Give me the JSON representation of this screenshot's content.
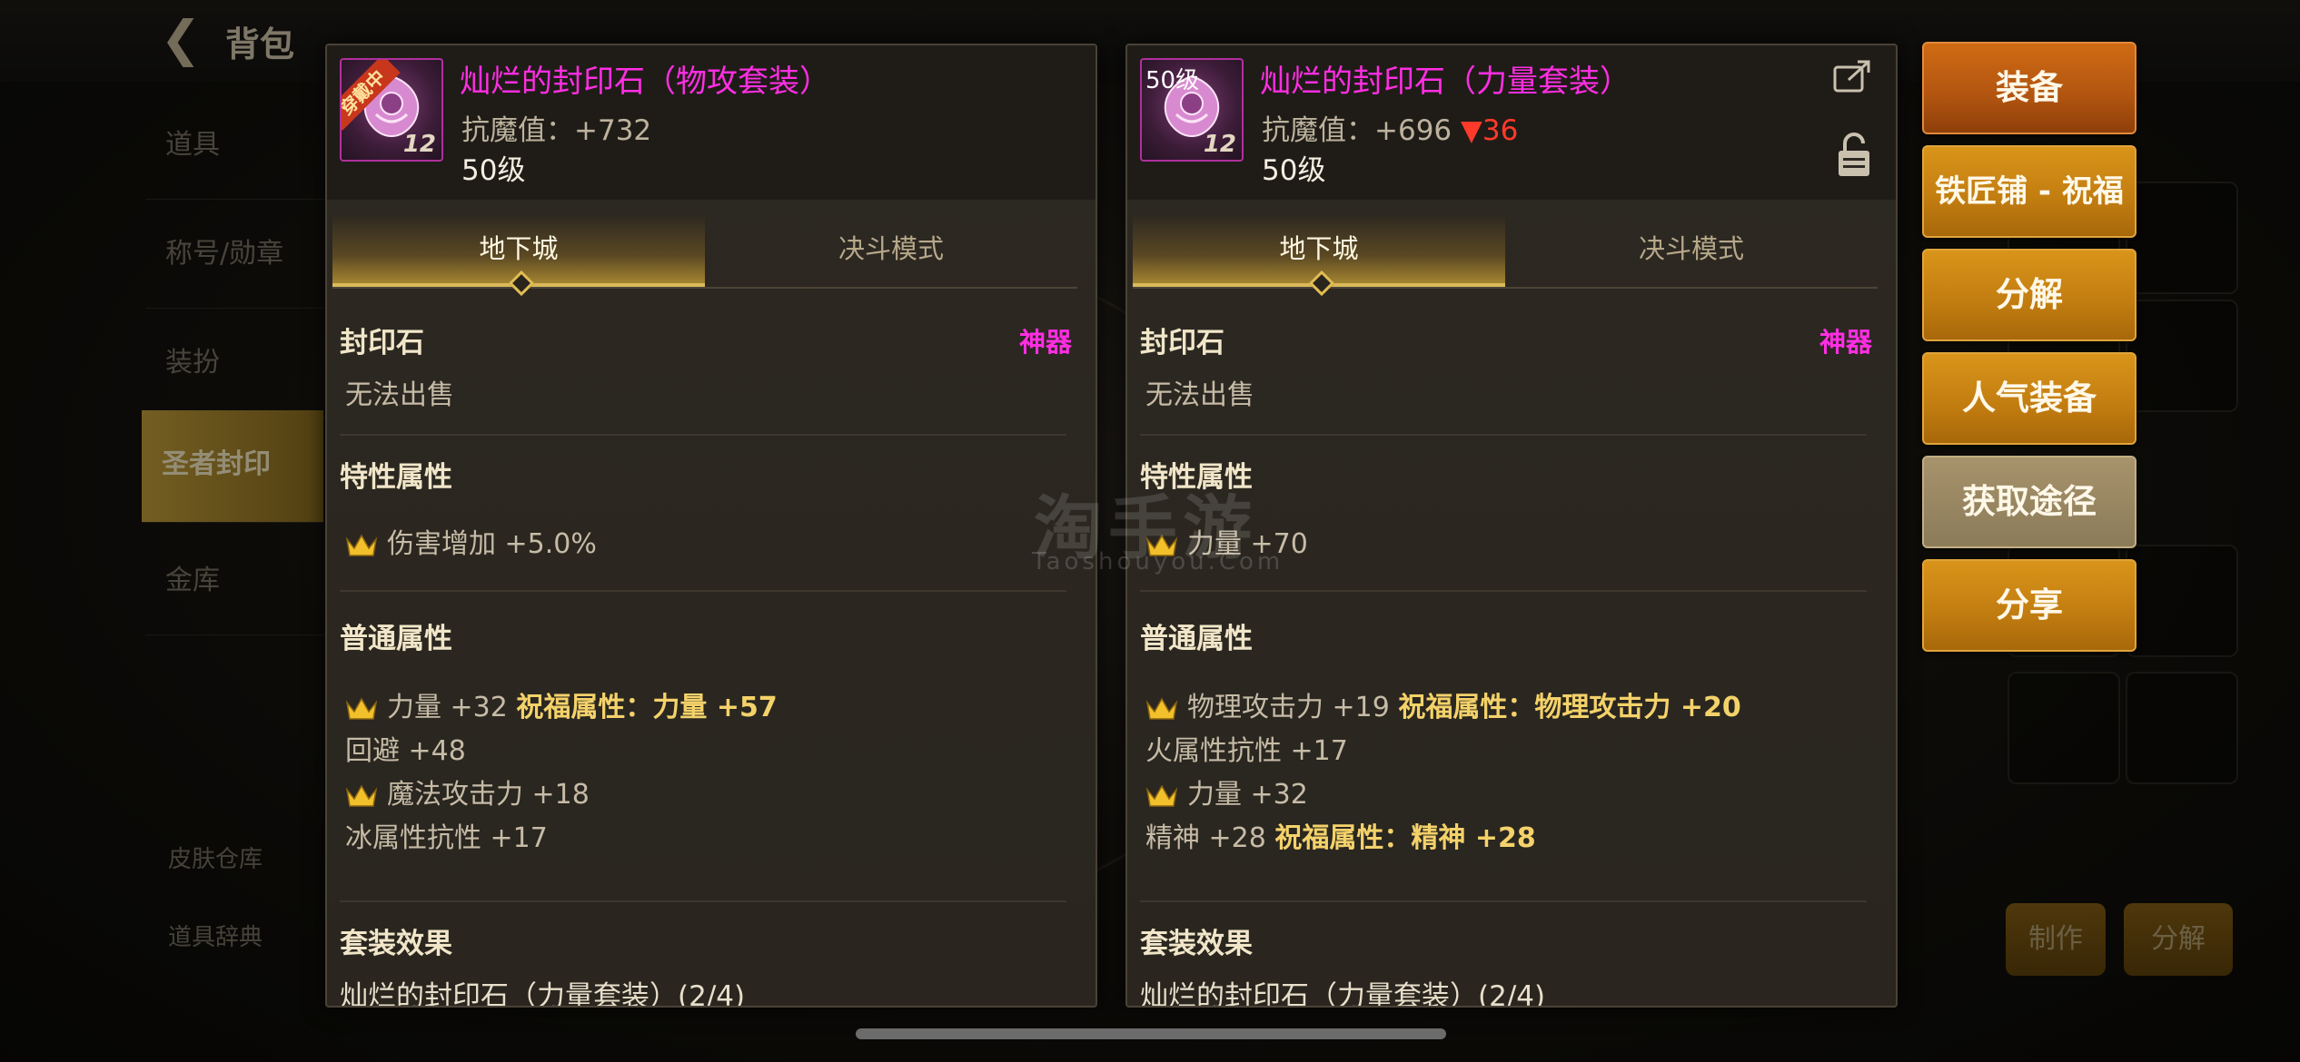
{
  "background": {
    "back_title": "背包",
    "side_items": [
      "道具",
      "称号/勋章",
      "装扮",
      "圣者封印",
      "金库"
    ],
    "side_bottom": [
      "皮肤仓库",
      "道具辞典"
    ],
    "bottom_buttons": [
      "制作",
      "分解"
    ]
  },
  "panels": [
    {
      "name": "灿烂的封印石（物攻套装）",
      "equipped_badge": "穿戴中",
      "icon_level": "12",
      "resist_label": "抗魔值：+732",
      "resist_diff": "",
      "level": "50级",
      "tabs": [
        "地下城",
        "决斗模式"
      ],
      "category": "封印石",
      "rarity": "神器",
      "trade": "无法出售",
      "trait_title": "特性属性",
      "traits": [
        {
          "text": "伤害增加 +5.0%",
          "crown": true,
          "bless": ""
        }
      ],
      "normal_title": "普通属性",
      "normals": [
        {
          "text": "力量 +32",
          "crown": true,
          "bless": "祝福属性：力量 +57"
        },
        {
          "text": "回避 +48",
          "crown": false,
          "bless": ""
        },
        {
          "text": "魔法攻击力 +18",
          "crown": true,
          "bless": ""
        },
        {
          "text": "冰属性抗性 +17",
          "crown": false,
          "bless": ""
        }
      ],
      "set_title": "套装效果",
      "set_name": "灿烂的封印石（力量套装）(2/4)"
    },
    {
      "name": "灿烂的封印石（力量套装）",
      "icon_top_label": "50级",
      "icon_level": "12",
      "resist_label": "抗魔值：+696",
      "resist_diff": "▼36",
      "level": "50级",
      "tabs": [
        "地下城",
        "决斗模式"
      ],
      "category": "封印石",
      "rarity": "神器",
      "trade": "无法出售",
      "trait_title": "特性属性",
      "traits": [
        {
          "text": "力量 +70",
          "crown": true,
          "bless": ""
        }
      ],
      "normal_title": "普通属性",
      "normals": [
        {
          "text": "物理攻击力 +19",
          "crown": true,
          "bless": "祝福属性：物理攻击力 +20"
        },
        {
          "text": "火属性抗性 +17",
          "crown": false,
          "bless": ""
        },
        {
          "text": "力量 +32",
          "crown": true,
          "bless": ""
        },
        {
          "text": "精神 +28",
          "crown": false,
          "bless": "祝福属性：精神 +28"
        }
      ],
      "set_title": "套装效果",
      "set_name": "灿烂的封印石（力量套装）(2/4)"
    }
  ],
  "actions": [
    "装备",
    "铁匠铺 - 祝福",
    "分解",
    "人气装备",
    "获取途径",
    "分享"
  ],
  "watermark": {
    "main": "淘手游",
    "sub": "Taoshouyou.Com"
  },
  "colors": {
    "item_name": "#ff2ee2",
    "bless": "#f4d26a",
    "down": "#ff3a2a",
    "button": "#c17c10"
  }
}
